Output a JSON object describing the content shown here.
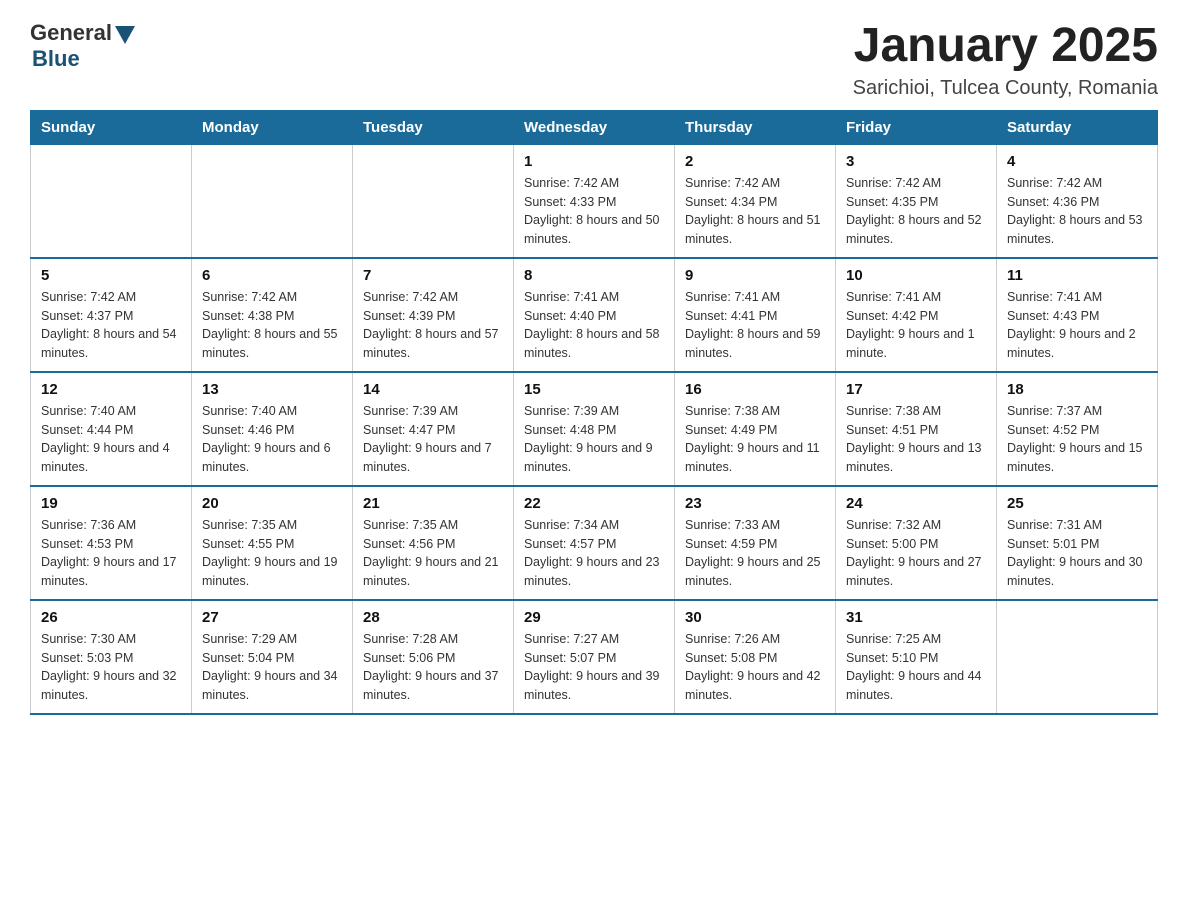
{
  "logo": {
    "general": "General",
    "blue": "Blue"
  },
  "title": "January 2025",
  "location": "Sarichioi, Tulcea County, Romania",
  "days_of_week": [
    "Sunday",
    "Monday",
    "Tuesday",
    "Wednesday",
    "Thursday",
    "Friday",
    "Saturday"
  ],
  "weeks": [
    [
      {
        "day": "",
        "info": ""
      },
      {
        "day": "",
        "info": ""
      },
      {
        "day": "",
        "info": ""
      },
      {
        "day": "1",
        "info": "Sunrise: 7:42 AM\nSunset: 4:33 PM\nDaylight: 8 hours\nand 50 minutes."
      },
      {
        "day": "2",
        "info": "Sunrise: 7:42 AM\nSunset: 4:34 PM\nDaylight: 8 hours\nand 51 minutes."
      },
      {
        "day": "3",
        "info": "Sunrise: 7:42 AM\nSunset: 4:35 PM\nDaylight: 8 hours\nand 52 minutes."
      },
      {
        "day": "4",
        "info": "Sunrise: 7:42 AM\nSunset: 4:36 PM\nDaylight: 8 hours\nand 53 minutes."
      }
    ],
    [
      {
        "day": "5",
        "info": "Sunrise: 7:42 AM\nSunset: 4:37 PM\nDaylight: 8 hours\nand 54 minutes."
      },
      {
        "day": "6",
        "info": "Sunrise: 7:42 AM\nSunset: 4:38 PM\nDaylight: 8 hours\nand 55 minutes."
      },
      {
        "day": "7",
        "info": "Sunrise: 7:42 AM\nSunset: 4:39 PM\nDaylight: 8 hours\nand 57 minutes."
      },
      {
        "day": "8",
        "info": "Sunrise: 7:41 AM\nSunset: 4:40 PM\nDaylight: 8 hours\nand 58 minutes."
      },
      {
        "day": "9",
        "info": "Sunrise: 7:41 AM\nSunset: 4:41 PM\nDaylight: 8 hours\nand 59 minutes."
      },
      {
        "day": "10",
        "info": "Sunrise: 7:41 AM\nSunset: 4:42 PM\nDaylight: 9 hours\nand 1 minute."
      },
      {
        "day": "11",
        "info": "Sunrise: 7:41 AM\nSunset: 4:43 PM\nDaylight: 9 hours\nand 2 minutes."
      }
    ],
    [
      {
        "day": "12",
        "info": "Sunrise: 7:40 AM\nSunset: 4:44 PM\nDaylight: 9 hours\nand 4 minutes."
      },
      {
        "day": "13",
        "info": "Sunrise: 7:40 AM\nSunset: 4:46 PM\nDaylight: 9 hours\nand 6 minutes."
      },
      {
        "day": "14",
        "info": "Sunrise: 7:39 AM\nSunset: 4:47 PM\nDaylight: 9 hours\nand 7 minutes."
      },
      {
        "day": "15",
        "info": "Sunrise: 7:39 AM\nSunset: 4:48 PM\nDaylight: 9 hours\nand 9 minutes."
      },
      {
        "day": "16",
        "info": "Sunrise: 7:38 AM\nSunset: 4:49 PM\nDaylight: 9 hours\nand 11 minutes."
      },
      {
        "day": "17",
        "info": "Sunrise: 7:38 AM\nSunset: 4:51 PM\nDaylight: 9 hours\nand 13 minutes."
      },
      {
        "day": "18",
        "info": "Sunrise: 7:37 AM\nSunset: 4:52 PM\nDaylight: 9 hours\nand 15 minutes."
      }
    ],
    [
      {
        "day": "19",
        "info": "Sunrise: 7:36 AM\nSunset: 4:53 PM\nDaylight: 9 hours\nand 17 minutes."
      },
      {
        "day": "20",
        "info": "Sunrise: 7:35 AM\nSunset: 4:55 PM\nDaylight: 9 hours\nand 19 minutes."
      },
      {
        "day": "21",
        "info": "Sunrise: 7:35 AM\nSunset: 4:56 PM\nDaylight: 9 hours\nand 21 minutes."
      },
      {
        "day": "22",
        "info": "Sunrise: 7:34 AM\nSunset: 4:57 PM\nDaylight: 9 hours\nand 23 minutes."
      },
      {
        "day": "23",
        "info": "Sunrise: 7:33 AM\nSunset: 4:59 PM\nDaylight: 9 hours\nand 25 minutes."
      },
      {
        "day": "24",
        "info": "Sunrise: 7:32 AM\nSunset: 5:00 PM\nDaylight: 9 hours\nand 27 minutes."
      },
      {
        "day": "25",
        "info": "Sunrise: 7:31 AM\nSunset: 5:01 PM\nDaylight: 9 hours\nand 30 minutes."
      }
    ],
    [
      {
        "day": "26",
        "info": "Sunrise: 7:30 AM\nSunset: 5:03 PM\nDaylight: 9 hours\nand 32 minutes."
      },
      {
        "day": "27",
        "info": "Sunrise: 7:29 AM\nSunset: 5:04 PM\nDaylight: 9 hours\nand 34 minutes."
      },
      {
        "day": "28",
        "info": "Sunrise: 7:28 AM\nSunset: 5:06 PM\nDaylight: 9 hours\nand 37 minutes."
      },
      {
        "day": "29",
        "info": "Sunrise: 7:27 AM\nSunset: 5:07 PM\nDaylight: 9 hours\nand 39 minutes."
      },
      {
        "day": "30",
        "info": "Sunrise: 7:26 AM\nSunset: 5:08 PM\nDaylight: 9 hours\nand 42 minutes."
      },
      {
        "day": "31",
        "info": "Sunrise: 7:25 AM\nSunset: 5:10 PM\nDaylight: 9 hours\nand 44 minutes."
      },
      {
        "day": "",
        "info": ""
      }
    ]
  ]
}
